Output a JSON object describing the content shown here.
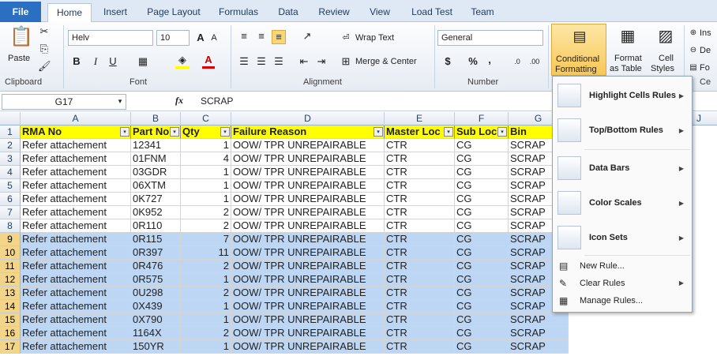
{
  "tabs": [
    "File",
    "Home",
    "Insert",
    "Page Layout",
    "Formulas",
    "Data",
    "Review",
    "View",
    "Load Test",
    "Team"
  ],
  "ribbon": {
    "clipboard": {
      "paste": "Paste",
      "label": "Clipboard"
    },
    "font": {
      "name": "Helv",
      "size": "10",
      "label": "Font",
      "bold": "B",
      "italic": "I",
      "underline": "U"
    },
    "alignment": {
      "wrap": "Wrap Text",
      "merge": "Merge & Center",
      "label": "Alignment"
    },
    "number": {
      "format": "General",
      "label": "Number",
      "currency": "$",
      "percent": "%",
      "comma": ","
    },
    "styles": {
      "conditional": "Conditional",
      "conditional2": "Formatting",
      "format_table": "Format",
      "format_table2": "as Table",
      "cell_styles": "Cell",
      "cell_styles2": "Styles"
    },
    "cells": {
      "insert": "Ins",
      "delete": "De",
      "format": "Fo",
      "label": "Ce"
    }
  },
  "formula_bar": {
    "name_box": "G17",
    "fx": "fx",
    "content": "SCRAP"
  },
  "columns": [
    "A",
    "B",
    "C",
    "D",
    "E",
    "F",
    "G",
    "J"
  ],
  "headers": [
    "RMA No",
    "Part No",
    "Qty",
    "Failure Reason",
    "Master Loc",
    "Sub Loc",
    "Bin"
  ],
  "rows": [
    {
      "n": "2",
      "a": "Refer attachement",
      "b": "12341",
      "c": "1",
      "d": "OOW/ TPR UNREPAIRABLE",
      "e": "CTR",
      "f": "CG",
      "g": "SCRAP"
    },
    {
      "n": "3",
      "a": "Refer attachement",
      "b": "01FNM",
      "c": "4",
      "d": "OOW/ TPR UNREPAIRABLE",
      "e": "CTR",
      "f": "CG",
      "g": "SCRAP"
    },
    {
      "n": "4",
      "a": "Refer attachement",
      "b": "03GDR",
      "c": "1",
      "d": "OOW/ TPR UNREPAIRABLE",
      "e": "CTR",
      "f": "CG",
      "g": "SCRAP"
    },
    {
      "n": "5",
      "a": "Refer attachement",
      "b": "06XTM",
      "c": "1",
      "d": "OOW/ TPR UNREPAIRABLE",
      "e": "CTR",
      "f": "CG",
      "g": "SCRAP"
    },
    {
      "n": "6",
      "a": "Refer attachement",
      "b": "0K727",
      "c": "1",
      "d": "OOW/ TPR UNREPAIRABLE",
      "e": "CTR",
      "f": "CG",
      "g": "SCRAP"
    },
    {
      "n": "7",
      "a": "Refer attachement",
      "b": "0K952",
      "c": "2",
      "d": "OOW/ TPR UNREPAIRABLE",
      "e": "CTR",
      "f": "CG",
      "g": "SCRAP"
    },
    {
      "n": "8",
      "a": "Refer attachement",
      "b": "0R110",
      "c": "2",
      "d": "OOW/ TPR UNREPAIRABLE",
      "e": "CTR",
      "f": "CG",
      "g": "SCRAP"
    },
    {
      "n": "9",
      "a": "Refer attachement",
      "b": "0R115",
      "c": "7",
      "d": "OOW/ TPR UNREPAIRABLE",
      "e": "CTR",
      "f": "CG",
      "g": "SCRAP"
    },
    {
      "n": "10",
      "a": "Refer attachement",
      "b": "0R397",
      "c": "11",
      "d": "OOW/ TPR UNREPAIRABLE",
      "e": "CTR",
      "f": "CG",
      "g": "SCRAP"
    },
    {
      "n": "11",
      "a": "Refer attachement",
      "b": "0R476",
      "c": "2",
      "d": "OOW/ TPR UNREPAIRABLE",
      "e": "CTR",
      "f": "CG",
      "g": "SCRAP"
    },
    {
      "n": "12",
      "a": "Refer attachement",
      "b": "0R575",
      "c": "1",
      "d": "OOW/ TPR UNREPAIRABLE",
      "e": "CTR",
      "f": "CG",
      "g": "SCRAP"
    },
    {
      "n": "13",
      "a": "Refer attachement",
      "b": "0U298",
      "c": "2",
      "d": "OOW/ TPR UNREPAIRABLE",
      "e": "CTR",
      "f": "CG",
      "g": "SCRAP"
    },
    {
      "n": "14",
      "a": "Refer attachement",
      "b": "0X439",
      "c": "1",
      "d": "OOW/ TPR UNREPAIRABLE",
      "e": "CTR",
      "f": "CG",
      "g": "SCRAP"
    },
    {
      "n": "15",
      "a": "Refer attachement",
      "b": "0X790",
      "c": "1",
      "d": "OOW/ TPR UNREPAIRABLE",
      "e": "CTR",
      "f": "CG",
      "g": "SCRAP"
    },
    {
      "n": "16",
      "a": "Refer attachement",
      "b": "1164X",
      "c": "2",
      "d": "OOW/ TPR UNREPAIRABLE",
      "e": "CTR",
      "f": "CG",
      "g": "SCRAP"
    },
    {
      "n": "17",
      "a": "Refer attachement",
      "b": "150YR",
      "c": "1",
      "d": "OOW/ TPR UNREPAIRABLE",
      "e": "CTR",
      "f": "CG",
      "g": "SCRAP"
    }
  ],
  "selected_from_row": 9,
  "menu": {
    "highlight": "Highlight Cells Rules",
    "topbottom": "Top/Bottom Rules",
    "databars": "Data Bars",
    "colorscales": "Color Scales",
    "iconsets": "Icon Sets",
    "newrule": "New Rule...",
    "clearrules": "Clear Rules",
    "managerules": "Manage Rules..."
  },
  "icons": {
    "dropdown": "▾",
    "submenu": "▶"
  }
}
